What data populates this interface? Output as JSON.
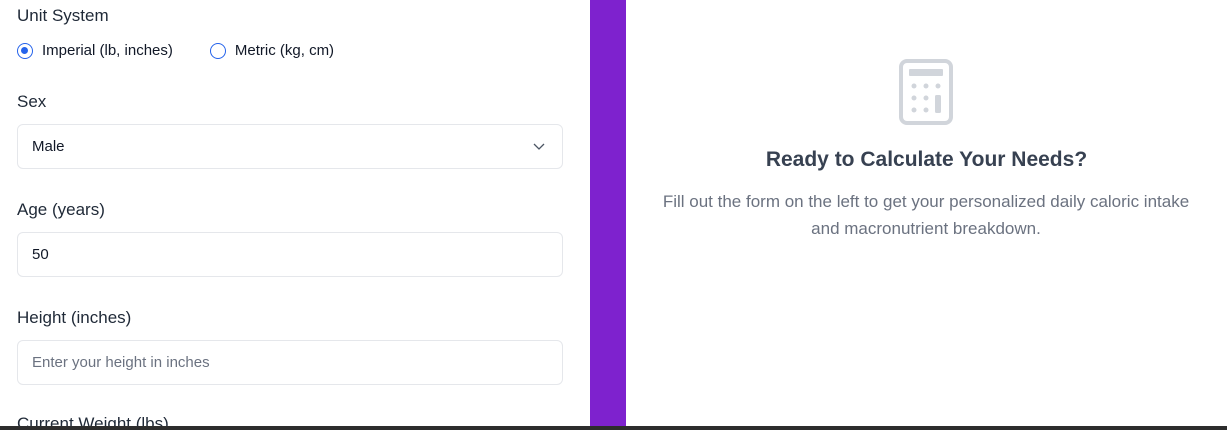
{
  "form": {
    "unit_system": {
      "label": "Unit System",
      "options": [
        {
          "label": "Imperial (lb, inches)",
          "checked": true
        },
        {
          "label": "Metric (kg, cm)",
          "checked": false
        }
      ]
    },
    "sex": {
      "label": "Sex",
      "value": "Male"
    },
    "age": {
      "label": "Age (years)",
      "value": "50"
    },
    "height": {
      "label": "Height (inches)",
      "placeholder": "Enter your height in inches"
    },
    "weight": {
      "label": "Current Weight (lbs)"
    }
  },
  "result_panel": {
    "icon": "calculator-icon",
    "title": "Ready to Calculate Your Needs?",
    "description": "Fill out the form on the left to get your personalized daily caloric intake and macronutrient breakdown."
  },
  "colors": {
    "accent": "#7e22ce",
    "radio": "#2563eb"
  }
}
